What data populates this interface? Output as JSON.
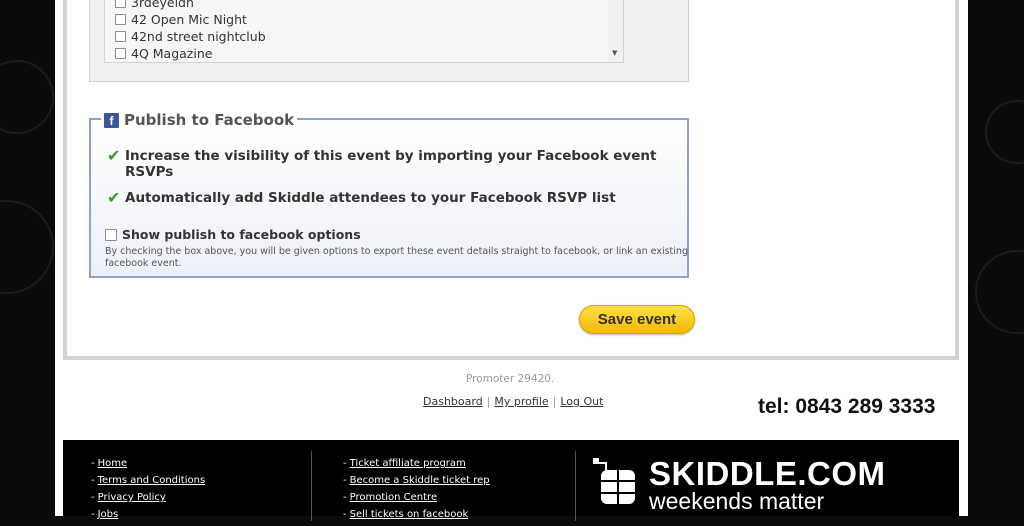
{
  "venue_list": {
    "items": [
      {
        "label": "3rdeyeldn"
      },
      {
        "label": "42 Open Mic Night"
      },
      {
        "label": "42nd street nightclub"
      },
      {
        "label": "4Q Magazine"
      }
    ],
    "scroll_icon": "arrow-down-icon"
  },
  "facebook": {
    "legend": "Publish to Facebook",
    "icon": "facebook-icon",
    "benefits": [
      "Increase the visibility of this event by importing your Facebook event RSVPs",
      "Automatically add Skiddle attendees to your Facebook RSVP list"
    ],
    "option_label": "Show publish to facebook options",
    "help_text": "By checking the box above, you will be given options to export these event details straight to facebook, or link an existing facebook event.",
    "check_color": "#3a9b22"
  },
  "save_button": "Save event",
  "promoter_text": "Promoter 29420.",
  "user_links": [
    "Dashboard",
    "My profile",
    "Log Out"
  ],
  "tel": "tel: 0843 289 3333",
  "footer": {
    "col1": [
      "Home",
      "Terms and Conditions",
      "Privacy Policy",
      "Jobs"
    ],
    "col2": [
      "Ticket affiliate program",
      "Become a Skiddle ticket rep",
      "Promotion Centre",
      "Sell tickets on facebook"
    ],
    "logo_name": "SKIDDLE.COM",
    "logo_tagline": "weekends matter"
  },
  "colors": {
    "accent_button": "#f4b800",
    "facebook_blue": "#3b5998",
    "fieldset_border": "#8fa2c8"
  }
}
